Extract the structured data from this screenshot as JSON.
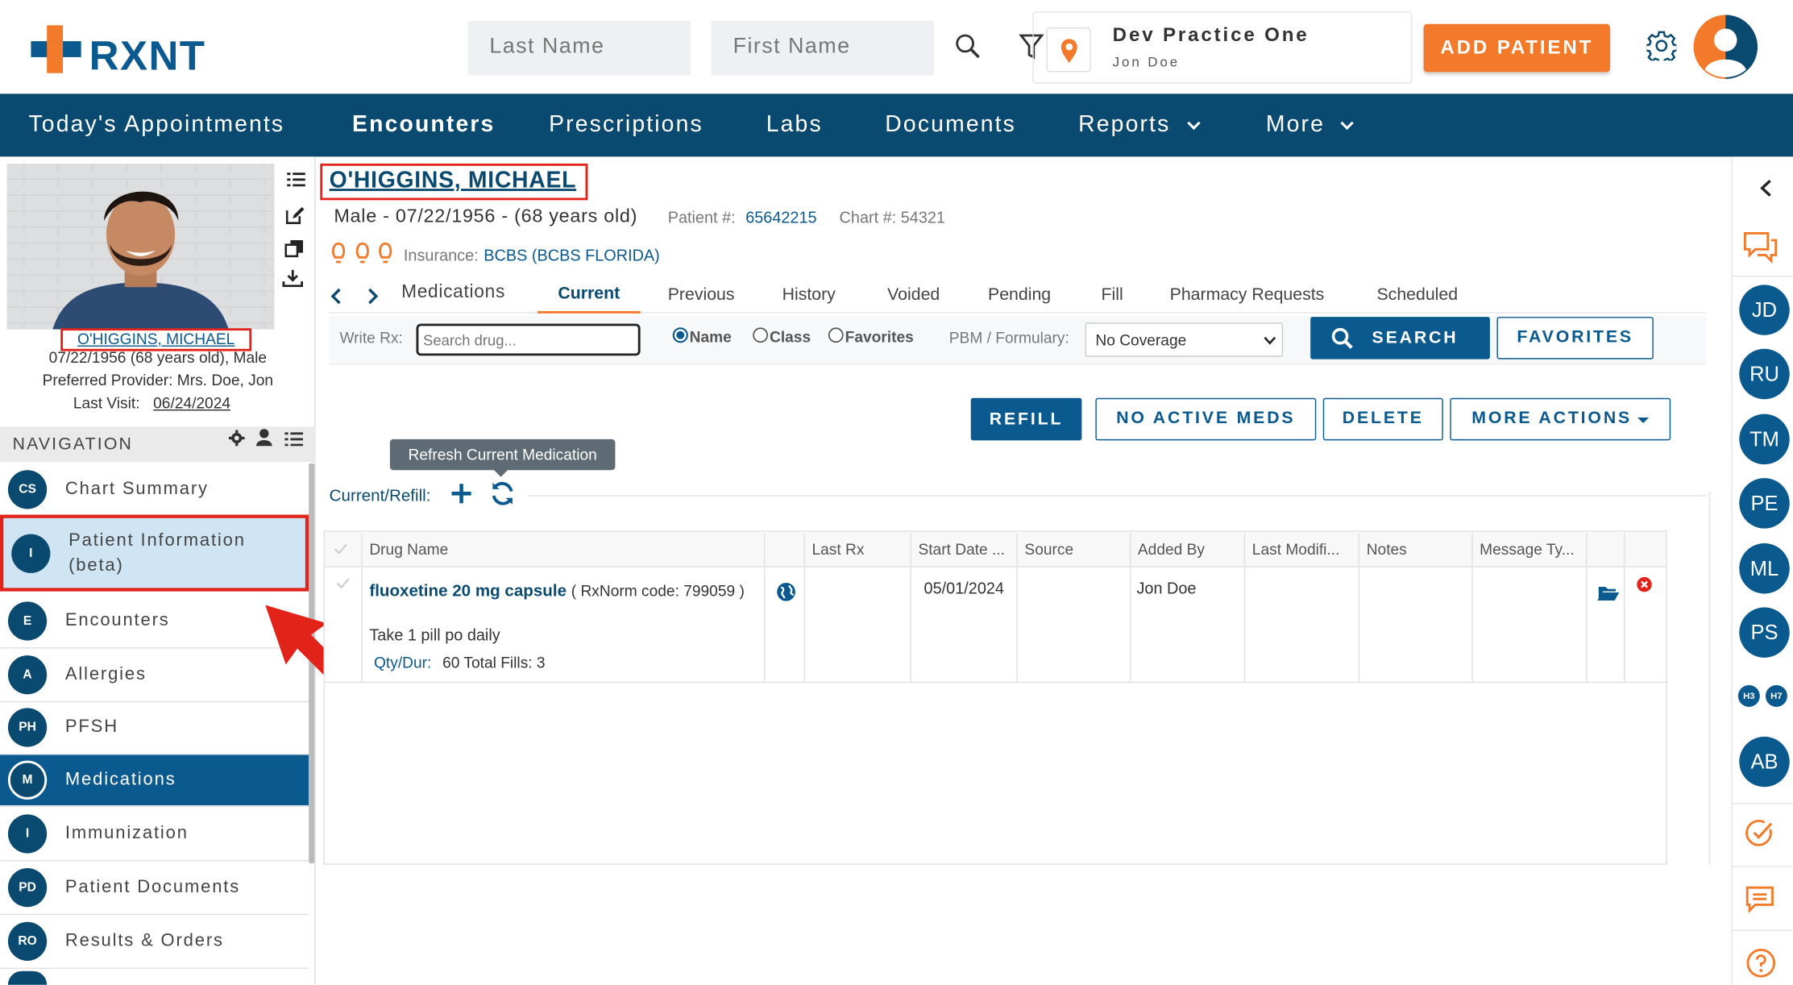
{
  "header": {
    "logo": "RXNT",
    "last_name_placeholder": "Last Name",
    "first_name_placeholder": "First Name",
    "practice_name": "Dev Practice One",
    "practice_user": "Jon Doe",
    "add_patient": "ADD PATIENT"
  },
  "nav": {
    "items": [
      "Today's Appointments",
      "Encounters",
      "Prescriptions",
      "Labs",
      "Documents",
      "Reports",
      "More"
    ]
  },
  "patient_card": {
    "name": "O'HIGGINS, MICHAEL",
    "dob_line": "07/22/1956 (68 years old), Male",
    "provider_line": "Preferred Provider: Mrs. Doe, Jon",
    "last_visit_label": "Last Visit:",
    "last_visit": "06/24/2024"
  },
  "navigation": {
    "heading": "NAVIGATION",
    "items": [
      {
        "abbr": "CS",
        "label": "Chart Summary"
      },
      {
        "abbr": "I",
        "label": "Patient Information (beta)"
      },
      {
        "abbr": "E",
        "label": "Encounters"
      },
      {
        "abbr": "A",
        "label": "Allergies"
      },
      {
        "abbr": "PH",
        "label": "PFSH"
      },
      {
        "abbr": "M",
        "label": "Medications"
      },
      {
        "abbr": "I",
        "label": "Immunization"
      },
      {
        "abbr": "PD",
        "label": "Patient Documents"
      },
      {
        "abbr": "RO",
        "label": "Results & Orders"
      }
    ]
  },
  "patient": {
    "name": "O'HIGGINS, MICHAEL",
    "demo": "Male - 07/22/1956 - (68 years old)",
    "patient_num_label": "Patient #:",
    "patient_num": "65642215",
    "chart_num": "Chart #: 54321",
    "insurance_label": "Insurance:",
    "insurance": "BCBS (BCBS FLORIDA)"
  },
  "tabs": {
    "section": "Medications",
    "items": [
      "Current",
      "Previous",
      "History",
      "Voided",
      "Pending",
      "Fill",
      "Pharmacy Requests",
      "Scheduled"
    ]
  },
  "writerx": {
    "label": "Write Rx:",
    "placeholder": "Search drug...",
    "radio_name": "Name",
    "radio_class": "Class",
    "radio_favorites": "Favorites",
    "pbm_label": "PBM / Formulary:",
    "pbm_value": "No Coverage",
    "search": "SEARCH",
    "favorites": "FAVORITES"
  },
  "actions": {
    "refill": "REFILL",
    "no_active": "NO ACTIVE MEDS",
    "delete": "DELETE",
    "more": "MORE ACTIONS"
  },
  "tooltip": "Refresh Current Medication",
  "current_refill_label": "Current/Refill:",
  "table": {
    "headers": [
      "Drug Name",
      "Last Rx",
      "Start Date ...",
      "Source",
      "Added By",
      "Last Modifi...",
      "Notes",
      "Message Ty..."
    ],
    "row": {
      "drug": "fluoxetine 20 mg capsule",
      "rxnorm": "( RxNorm code: 799059 )",
      "sig": "Take 1 pill po daily",
      "qty_label": "Qty/Dur:",
      "qty": "60 Total Fills: 3",
      "start_date": "05/01/2024",
      "added_by": "Jon Doe"
    }
  },
  "right_bar": {
    "avatars": [
      "JD",
      "RU",
      "TM",
      "PE",
      "ML",
      "PS",
      "AB"
    ],
    "small": [
      "H3",
      "H7"
    ]
  },
  "colors": {
    "brand": "#0b4a70",
    "accent": "#f37a2a",
    "highlight": "#e2231a"
  }
}
